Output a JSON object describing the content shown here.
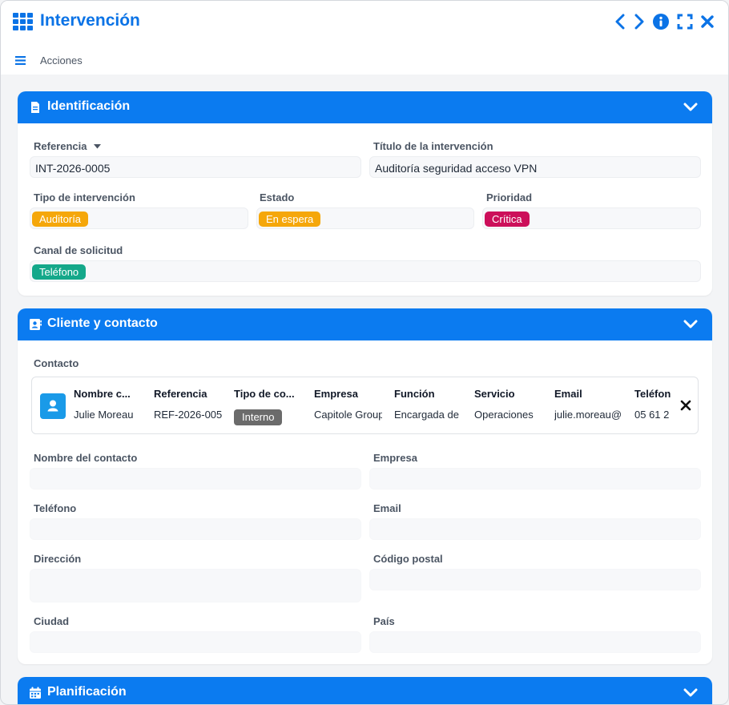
{
  "window": {
    "title": "Intervención",
    "actions_label": "Acciones",
    "accent": "#0b7bf0"
  },
  "icons": {
    "app": "grid-icon",
    "prev": "chevron-left-icon",
    "next": "chevron-right-icon",
    "info": "info-icon",
    "fullscreen": "fullscreen-icon",
    "close": "close-icon",
    "menu": "hamburger-icon"
  },
  "identificacion": {
    "title": "Identificación",
    "referencia_label": "Referencia",
    "referencia_value": "INT-2026-0005",
    "titulo_label": "Título de la intervención",
    "titulo_value": "Auditoría seguridad acceso VPN",
    "tipo_label": "Tipo de intervención",
    "tipo_value": "Auditoría",
    "tipo_color": "#f5a70a",
    "estado_label": "Estado",
    "estado_value": "En espera",
    "estado_color": "#f5a70a",
    "prioridad_label": "Prioridad",
    "prioridad_value": "Crítica",
    "prioridad_color": "#cc0f5a",
    "canal_label": "Canal de solicitud",
    "canal_value": "Teléfono",
    "canal_color": "#14a88a"
  },
  "cliente": {
    "title": "Cliente y contacto",
    "contacto_label": "Contacto",
    "columns": [
      "Nombre c...",
      "Referencia",
      "Tipo de co...",
      "Empresa",
      "Función",
      "Servicio",
      "Email",
      "Teléfon"
    ],
    "row": {
      "nombre": "Julie Moreau",
      "referencia": "REF-2026-005",
      "tipo": "Interno",
      "empresa": "Capitole Group",
      "funcion": "Encargada de",
      "servicio": "Operaciones",
      "email": "julie.moreau@",
      "telefono": "05 61 2"
    },
    "fields": {
      "nombre_label": "Nombre del contacto",
      "empresa_label": "Empresa",
      "telefono_label": "Teléfono",
      "email_label": "Email",
      "direccion_label": "Dirección",
      "codigo_label": "Código postal",
      "ciudad_label": "Ciudad",
      "pais_label": "País"
    }
  },
  "planificacion": {
    "title": "Planificación"
  }
}
